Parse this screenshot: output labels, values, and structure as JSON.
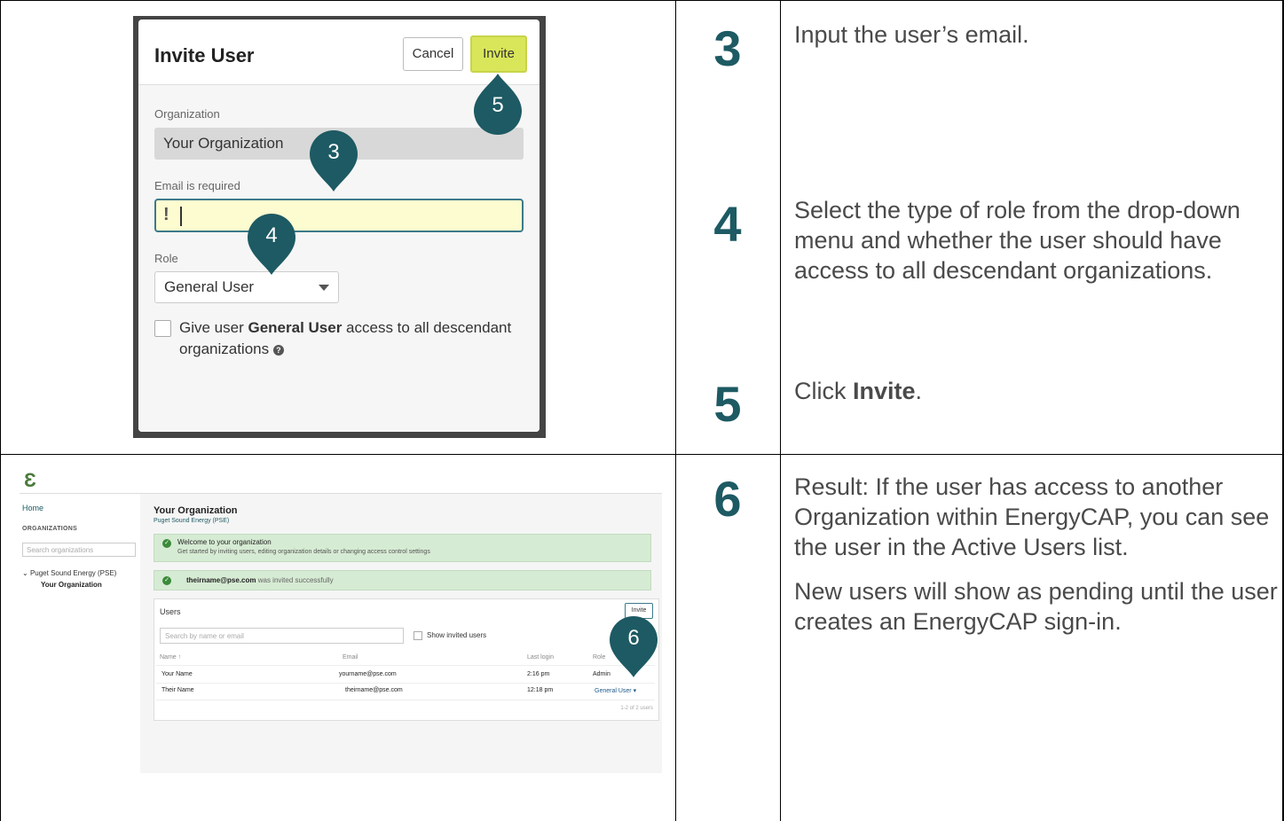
{
  "steps": [
    {
      "number": "3",
      "text": "Input the user’s email."
    },
    {
      "number": "4",
      "text": "Select the type of role from the drop-down menu and whether the user should have access to all descendant organizations."
    },
    {
      "number": "5",
      "text_prefix": "Click ",
      "text_bold": "Invite",
      "text_suffix": "."
    },
    {
      "number": "6",
      "paragraphs": [
        "Result: If the user has access to another Organization within EnergyCAP, you can see the user in the Active Users list.",
        "New users will show as pending until the user creates an EnergyCAP sign-in."
      ]
    }
  ],
  "modal": {
    "title": "Invite User",
    "cancel_label": "Cancel",
    "invite_label": "Invite",
    "org_label": "Organization",
    "org_value": "Your Organization",
    "email_label": "Email is required",
    "email_value": "",
    "email_warning": "!",
    "role_label": "Role",
    "role_value": "General User",
    "checkbox_text_pre": "Give user ",
    "checkbox_text_bold": "General User",
    "checkbox_text_post": " access to all descendant organizations",
    "help_glyph": "?"
  },
  "pins": {
    "p3": "3",
    "p4": "4",
    "p5": "5",
    "p6": "6"
  },
  "app": {
    "logo": "Ɛ",
    "sidebar": {
      "home": "Home",
      "heading": "ORGANIZATIONS",
      "search_placeholder": "Search organizations",
      "tree_parent": "Puget Sound Energy (PSE)",
      "tree_child": "Your Organization"
    },
    "title": "Your Organization",
    "subtitle": "Puget Sound Energy (PSE)",
    "welcome_title": "Welcome to your organization",
    "welcome_body": "Get started by inviting users, editing organization details or changing access control settings",
    "invited_email": "theirname@pse.com",
    "invited_msg": " was invited successfully",
    "users": {
      "title": "Users",
      "invite_label": "Invite",
      "search_placeholder": "Search by name or email",
      "show_invited": "Show invited users",
      "columns": [
        "Name ↑",
        "Email",
        "Last login",
        "Role"
      ],
      "rows": [
        {
          "name": "Your Name",
          "email": "yourname@pse.com",
          "last_login": "2:16 pm",
          "role": "Admin"
        },
        {
          "name": "Their Name",
          "email": "theirname@pse.com",
          "last_login": "12:18 pm",
          "role": "General User ▾"
        }
      ],
      "paging": "1-2 of 2 users"
    }
  },
  "colors": {
    "step_number": "#1d5a63",
    "pin": "#1d5a63",
    "invite_button": "#d9e65a",
    "email_highlight": "#fdfbd0"
  }
}
